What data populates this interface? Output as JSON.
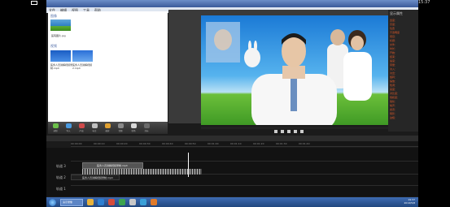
{
  "overlay": {
    "time": "15:37"
  },
  "menu": {
    "items": [
      "文件",
      "编辑",
      "视图",
      "工具",
      "帮助"
    ]
  },
  "clip_bin": {
    "images_label": "图像",
    "videos_label": "视频",
    "image_item": "医院图片.jpg",
    "video_items": [
      "医务人员讲解视频录制.mp4",
      "医务人员讲解视频2.mp4"
    ]
  },
  "properties": {
    "title": "显示属性",
    "rows": [
      "宽度：",
      "高度：",
      "位置",
      "不透明度",
      "项目：",
      "标题：",
      "文件：",
      "时长：",
      "开始：",
      "结束：",
      "速度：",
      "音量：",
      "淡入：",
      "淡出：",
      "旋转：",
      "缩放：",
      "色调：",
      "亮度：",
      "对比度：",
      "饱和度：",
      "锐化：",
      "噪声：",
      "遮罩：",
      "阴影：",
      "边框："
    ]
  },
  "tasks": [
    "录制",
    "导入",
    "产出",
    "标注",
    "缩放",
    "音频",
    "转场",
    "光标"
  ],
  "timeline": {
    "ticks": [
      "00:00:00",
      "00:00:10",
      "00:00:20",
      "00:00:30",
      "00:00:40",
      "00:00:50",
      "00:01:00",
      "00:01:10",
      "00:01:20",
      "00:01:30",
      "00:01:40"
    ],
    "tracks": [
      "轨道 3",
      "轨道 2",
      "轨道 1"
    ],
    "video_clip": "医务人员讲解视频录制.mp4",
    "audio_clip": "医务人员讲解视频录制.mp4"
  },
  "taskbar": {
    "active": "演示录像",
    "time": "19:37",
    "date": "2014/5/8"
  },
  "colors": {
    "accent": "#5570aa",
    "orange": "#e05a2a",
    "taskbar": "#21477f"
  }
}
